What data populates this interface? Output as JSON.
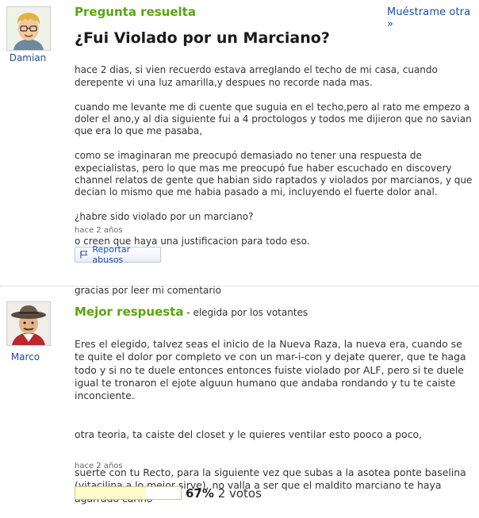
{
  "question": {
    "header": "Pregunta resuelta",
    "more_link": "Muéstrame otra »",
    "user": {
      "name": "Damian",
      "avatar_icon": "cartoon-avatar-blonde-glasses"
    },
    "title": "¿Fui Violado por un Marciano?",
    "body": [
      "hace 2 dias, si vien recuerdo estava arreglando el techo de mi casa, cuando derepente vi una luz amarilla,y despues no recorde nada mas.",
      "cuando me levante me di cuente que suguia en el techo,pero al rato me empezo a doler el ano,y al dia siguiente fui a 4 proctologos y todos me dijieron que no savian que era lo que me pasaba,",
      "como se imaginaran me preocupó demasiado no tener una respuesta de expecialistas, pero lo que mas me preocupó fue haber escuchado en discovery channel relatos de gente que habian sido raptados y violados por marcianos, y que decian lo mismo que me habia pasado a mi, incluyendo el fuerte dolor anal.",
      "¿habre sido violado por un marciano?",
      "o creen que haya una justificacion para todo eso.",
      "",
      "gracias por leer mi comentario"
    ],
    "time": "hace 2 años",
    "report_label": "Reportar abusos"
  },
  "answer": {
    "header": "Mejor respuesta",
    "header_sub": " - elegida por los votantes",
    "user": {
      "name": "Marco",
      "avatar_icon": "cartoon-avatar-cowboy-hat"
    },
    "paragraphs": [
      "Eres el elegido, talvez seas el inicio de la Nueva Raza, la nueva era, cuando se te quite el dolor por completo ve con un mar-i-con y dejate querer, que te haga todo y si no te duele entonces entonces fuiste violado por ALF, pero si te duele igual te tronaron el ejote alguun humano que andaba rondando y tu te caiste inconciente.",
      "otra teoria, ta caiste del closet y le quieres ventilar esto pooco a poco,",
      "suerte con tu Recto, para la siguiente vez que subas a la asotea ponte baselina (vitacilina a lo mejor sirve), no valla a ser que el maldito marciano te haya agarrado cariño"
    ],
    "time": "hace 2 años",
    "vote_percent": "67%",
    "vote_count": "2 votos",
    "vote_fraction": 0.67
  },
  "colors": {
    "header_green": "#5aa50f",
    "link_blue": "#1b4fa5",
    "vote_fill": "#fdfbc8"
  }
}
